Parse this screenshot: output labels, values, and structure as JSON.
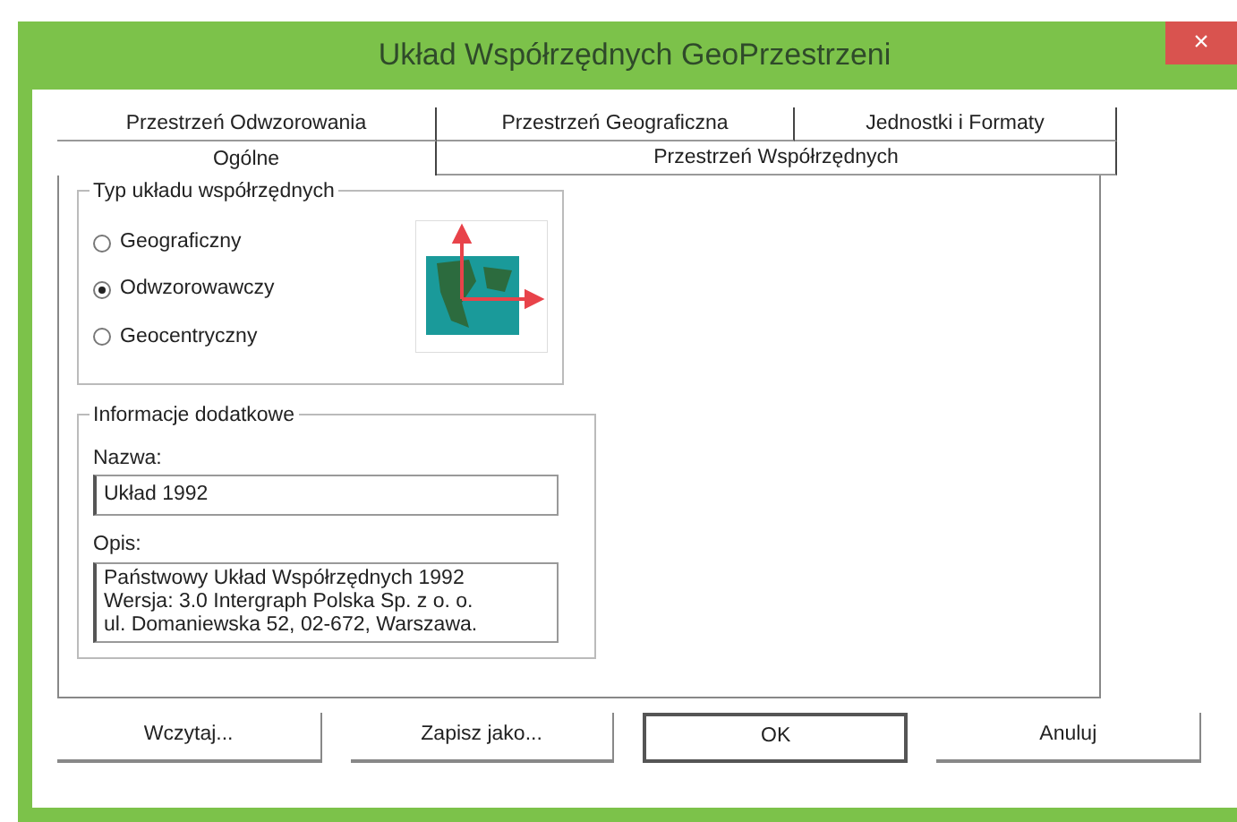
{
  "window": {
    "title": "Układ Współrzędnych GeoPrzestrzeni",
    "close": "×"
  },
  "tab_rows": [
    [
      {
        "label": "Przestrzeń Odwzorowania",
        "selected": false
      },
      {
        "label": "Przestrzeń Geograficzna",
        "selected": false
      },
      {
        "label": "Jednostki i Formaty",
        "selected": false
      }
    ],
    [
      {
        "label": "Ogólne",
        "selected": true
      },
      {
        "label": "Przestrzeń Współrzędnych",
        "selected": false
      }
    ]
  ],
  "coordinate_type": {
    "legend": "Typ układu współrzędnych",
    "options": [
      {
        "label": "Geograficzny",
        "selected": false
      },
      {
        "label": "Odwzorowawczy",
        "selected": true
      },
      {
        "label": "Geocentryczny",
        "selected": false
      }
    ]
  },
  "additional_info": {
    "legend": "Informacje dodatkowe",
    "name_label": "Nazwa:",
    "name_value": "Układ 1992",
    "description_label": "Opis:",
    "description_lines": [
      "Państwowy Układ Współrzędnych 1992",
      "Wersja: 3.0 Intergraph Polska Sp. z o. o.",
      "ul. Domaniewska 52, 02-672, Warszawa."
    ]
  },
  "buttons": [
    {
      "label": "Wczytaj...",
      "default": false
    },
    {
      "label": "Zapisz jako...",
      "default": false
    },
    {
      "label": "OK",
      "default": true
    },
    {
      "label": "Anuluj",
      "default": false
    }
  ]
}
